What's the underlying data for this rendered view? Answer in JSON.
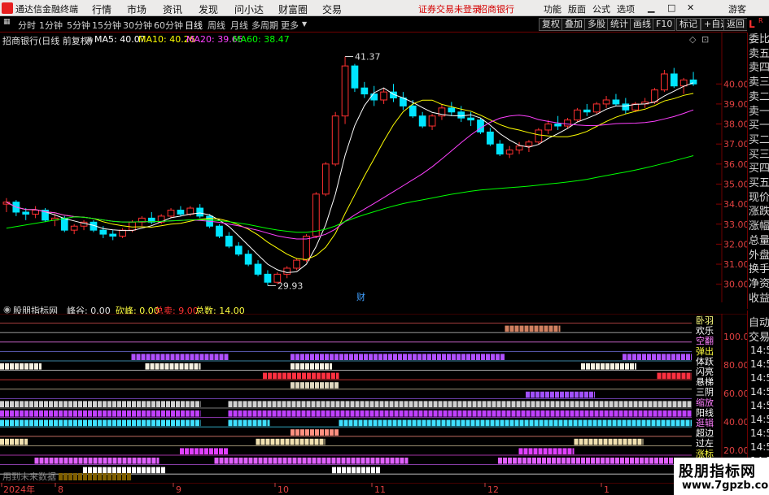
{
  "menubar": {
    "app_title": "通达信金融终端",
    "items": [
      "行情",
      "市场",
      "资讯",
      "发现",
      "问小达",
      "财富圈",
      "交易"
    ],
    "notice_login": "证券交易未登录",
    "notice_stock": "招商银行",
    "right_items": [
      "功能",
      "版面",
      "公式",
      "选项"
    ],
    "window_buttons": [
      "▁",
      "□",
      "✕"
    ],
    "guest": "游客"
  },
  "toolbar": {
    "periods": [
      "分时",
      "1分钟",
      "5分钟",
      "15分钟",
      "30分钟",
      "60分钟",
      "日线",
      "周线",
      "月线",
      "多周期",
      "更多"
    ],
    "active_period": "日线",
    "right_buttons": [
      "复权",
      "叠加",
      "多股",
      "统计",
      "画线",
      "F10",
      "标记",
      "+自选",
      "返回"
    ]
  },
  "chart_header": {
    "title": "招商银行(日线 前复权)",
    "ma5": "MA5: 40.07",
    "ma10": "MA10: 40.26",
    "ma20": "MA20: 39.65",
    "ma60": "MA60: 38.47",
    "colors": {
      "ma5": "#ffffff",
      "ma10": "#ffff00",
      "ma20": "#ff40ff",
      "ma60": "#00ff00"
    }
  },
  "price_axis": {
    "ticks": [
      "40.00",
      "39.00",
      "38.00",
      "37.00",
      "36.00",
      "35.00",
      "34.00",
      "33.00",
      "32.00",
      "31.00",
      "30.00"
    ]
  },
  "annotations": {
    "high": "41.37",
    "low": "29.93",
    "finance_marker": "财"
  },
  "side_panel": {
    "lr_l": "L",
    "lr_r": "R",
    "labels": [
      "委比",
      "卖五",
      "卖四",
      "卖三",
      "卖二",
      "卖一",
      "买一",
      "买二",
      "买三",
      "买四",
      "买五",
      "现价",
      "涨跌",
      "涨幅",
      "总量",
      "外盘",
      "换手",
      "净资",
      "收益"
    ]
  },
  "indicator": {
    "name": "股朋指标网",
    "items": [
      {
        "label": "峰谷: 0.00",
        "color": "#e0e0e0"
      },
      {
        "label": "砍峰: 0.00",
        "color": "#ffff40"
      },
      {
        "label": "总卖: 9.00",
        "color": "#ff3030"
      },
      {
        "label": "总数: 14.00",
        "color": "#ffff40"
      }
    ],
    "axis_values": [
      "100.0",
      "80.00",
      "60.00",
      "40.00",
      "20.00"
    ],
    "row_labels": [
      "卧羽",
      "欢乐",
      "空翻",
      "弹出",
      "体跃",
      "闪亮",
      "悬梯",
      "三阴",
      "缩放",
      "阳线",
      "逛辑",
      "超边",
      "过左",
      "涨标",
      "张场"
    ],
    "footer_text": "用到未来数据"
  },
  "side_panel2": {
    "labels": [
      "自动",
      "交易"
    ],
    "times": [
      "14:56",
      "14:56",
      "14:56",
      "14:56",
      "14:56",
      "14:56",
      "14:56",
      "14:56",
      "14:56"
    ]
  },
  "x_axis": {
    "labels": [
      "2024年",
      "8",
      "9",
      "10",
      "11",
      "12",
      "1"
    ]
  },
  "watermark": {
    "line1": "股朋指标网",
    "line2": "www.7gpzb.com"
  },
  "chart_data": {
    "type": "candlestick",
    "title": "招商银行(日线 前复权)",
    "ylim": [
      29.5,
      42.0
    ],
    "up_color": "#ff3030",
    "down_color": "#00e5ff",
    "candles": [
      [
        34.0,
        34.3,
        33.6,
        34.1
      ],
      [
        34.1,
        34.2,
        33.4,
        33.6
      ],
      [
        33.6,
        33.8,
        33.2,
        33.5
      ],
      [
        33.5,
        33.9,
        33.3,
        33.7
      ],
      [
        33.7,
        33.8,
        33.1,
        33.2
      ],
      [
        33.2,
        33.5,
        32.9,
        33.3
      ],
      [
        33.3,
        33.4,
        32.6,
        32.7
      ],
      [
        32.7,
        33.0,
        32.5,
        32.9
      ],
      [
        32.9,
        33.2,
        32.7,
        33.1
      ],
      [
        33.1,
        33.2,
        32.6,
        32.7
      ],
      [
        32.7,
        32.9,
        32.3,
        32.5
      ],
      [
        32.5,
        32.7,
        32.2,
        32.4
      ],
      [
        32.4,
        32.8,
        32.3,
        32.7
      ],
      [
        32.7,
        33.2,
        32.6,
        33.1
      ],
      [
        33.1,
        33.4,
        32.9,
        33.3
      ],
      [
        33.3,
        33.6,
        33.0,
        33.1
      ],
      [
        33.1,
        33.5,
        33.0,
        33.4
      ],
      [
        33.4,
        33.8,
        33.3,
        33.7
      ],
      [
        33.7,
        33.9,
        33.4,
        33.5
      ],
      [
        33.5,
        33.9,
        33.4,
        33.8
      ],
      [
        33.8,
        34.0,
        33.3,
        33.4
      ],
      [
        33.4,
        33.5,
        32.8,
        32.9
      ],
      [
        32.9,
        33.0,
        32.3,
        32.4
      ],
      [
        32.4,
        32.6,
        31.8,
        31.9
      ],
      [
        31.9,
        32.1,
        31.4,
        31.5
      ],
      [
        31.5,
        31.7,
        30.9,
        31.0
      ],
      [
        31.0,
        31.2,
        30.4,
        30.5
      ],
      [
        30.5,
        30.7,
        29.93,
        30.1
      ],
      [
        30.1,
        30.6,
        30.0,
        30.5
      ],
      [
        30.5,
        30.9,
        30.3,
        30.8
      ],
      [
        30.8,
        31.3,
        30.7,
        31.2
      ],
      [
        31.2,
        32.5,
        31.1,
        32.4
      ],
      [
        32.4,
        34.6,
        32.3,
        34.5
      ],
      [
        34.5,
        36.1,
        34.4,
        36.0
      ],
      [
        36.0,
        38.6,
        35.9,
        38.4
      ],
      [
        38.4,
        41.37,
        38.0,
        40.9
      ],
      [
        40.9,
        41.0,
        39.6,
        39.8
      ],
      [
        39.8,
        40.1,
        39.3,
        39.5
      ],
      [
        39.5,
        39.9,
        38.9,
        39.2
      ],
      [
        39.2,
        39.8,
        39.0,
        39.6
      ],
      [
        39.6,
        40.0,
        39.1,
        39.3
      ],
      [
        39.3,
        39.6,
        38.7,
        38.9
      ],
      [
        38.9,
        39.2,
        38.3,
        38.4
      ],
      [
        38.4,
        38.6,
        37.8,
        37.9
      ],
      [
        37.9,
        38.5,
        37.7,
        38.4
      ],
      [
        38.4,
        39.0,
        38.2,
        38.8
      ],
      [
        38.8,
        39.1,
        38.4,
        38.6
      ],
      [
        38.6,
        38.9,
        38.1,
        38.3
      ],
      [
        38.3,
        38.6,
        37.9,
        38.2
      ],
      [
        38.2,
        38.3,
        37.5,
        37.6
      ],
      [
        37.6,
        37.8,
        36.9,
        37.0
      ],
      [
        37.0,
        37.2,
        36.4,
        36.5
      ],
      [
        36.5,
        36.9,
        36.3,
        36.7
      ],
      [
        36.7,
        37.1,
        36.5,
        36.9
      ],
      [
        36.9,
        37.2,
        36.6,
        37.1
      ],
      [
        37.1,
        37.8,
        37.0,
        37.7
      ],
      [
        37.7,
        38.2,
        37.5,
        38.0
      ],
      [
        38.0,
        38.4,
        37.7,
        37.9
      ],
      [
        37.9,
        38.3,
        37.8,
        38.2
      ],
      [
        38.2,
        38.8,
        38.1,
        38.7
      ],
      [
        38.7,
        39.0,
        38.4,
        38.6
      ],
      [
        38.6,
        39.1,
        38.5,
        39.0
      ],
      [
        39.0,
        39.4,
        38.8,
        39.2
      ],
      [
        39.2,
        39.5,
        38.9,
        39.0
      ],
      [
        39.0,
        39.3,
        38.5,
        38.7
      ],
      [
        38.7,
        39.1,
        38.6,
        39.0
      ],
      [
        39.0,
        39.3,
        38.8,
        39.1
      ],
      [
        39.1,
        39.8,
        39.0,
        39.7
      ],
      [
        39.7,
        40.7,
        39.6,
        40.5
      ],
      [
        40.5,
        40.8,
        39.8,
        39.9
      ],
      [
        39.9,
        40.3,
        39.5,
        40.2
      ],
      [
        40.2,
        40.6,
        39.9,
        40.0
      ]
    ],
    "ma_series": [
      {
        "name": "MA5",
        "color": "#ffffff"
      },
      {
        "name": "MA10",
        "color": "#ffff00"
      },
      {
        "name": "MA20",
        "color": "#ff40ff"
      },
      {
        "name": "MA60",
        "color": "#00ff00"
      }
    ]
  },
  "indicator_rows": [
    {
      "color": "#ff5050",
      "segments": []
    },
    {
      "color": "#d08060",
      "segments": [
        [
          0.73,
          0.81
        ]
      ]
    },
    {
      "color": "#7050ff",
      "segments": []
    },
    {
      "color": "#ff50ff",
      "segments": []
    },
    {
      "color": "#b050ff",
      "segments": [
        [
          0.19,
          0.33
        ],
        [
          0.42,
          0.73
        ],
        [
          0.9,
          1.0
        ]
      ]
    },
    {
      "color": "#f5f0e0",
      "segments": [
        [
          0.0,
          0.06
        ],
        [
          0.21,
          0.29
        ],
        [
          0.42,
          0.48
        ],
        [
          0.84,
          0.92
        ]
      ]
    },
    {
      "color": "#ff3040",
      "segments": [
        [
          0.38,
          0.49
        ],
        [
          0.95,
          1.0
        ]
      ]
    },
    {
      "color": "#e0d8c0",
      "segments": [
        [
          0.42,
          0.49
        ]
      ]
    },
    {
      "color": "#a050ff",
      "segments": [
        [
          0.76,
          0.86
        ]
      ]
    },
    {
      "color": "#d0d0d0",
      "segments": [
        [
          0.0,
          0.29
        ],
        [
          0.33,
          1.0
        ]
      ]
    },
    {
      "color": "#c040ff",
      "segments": [
        [
          0.0,
          0.29
        ],
        [
          0.33,
          1.0
        ]
      ]
    },
    {
      "color": "#40e0ff",
      "segments": [
        [
          0.0,
          0.29
        ],
        [
          0.33,
          0.39
        ],
        [
          0.49,
          1.0
        ]
      ]
    },
    {
      "color": "#ff9080",
      "segments": [
        [
          0.42,
          0.49
        ]
      ]
    },
    {
      "color": "#f0e0b0",
      "segments": [
        [
          0.0,
          0.04
        ],
        [
          0.37,
          0.47
        ],
        [
          0.83,
          0.93
        ]
      ]
    },
    {
      "color": "#e040ff",
      "segments": [
        [
          0.26,
          0.33
        ],
        [
          0.75,
          0.83
        ]
      ]
    },
    {
      "color": "#e060ff",
      "segments": [
        [
          0.05,
          0.23
        ],
        [
          0.31,
          0.59
        ],
        [
          0.72,
          1.0
        ]
      ]
    },
    {
      "color": "#ffffff",
      "segments": [
        [
          0.12,
          0.24
        ],
        [
          0.48,
          0.55
        ]
      ]
    }
  ]
}
